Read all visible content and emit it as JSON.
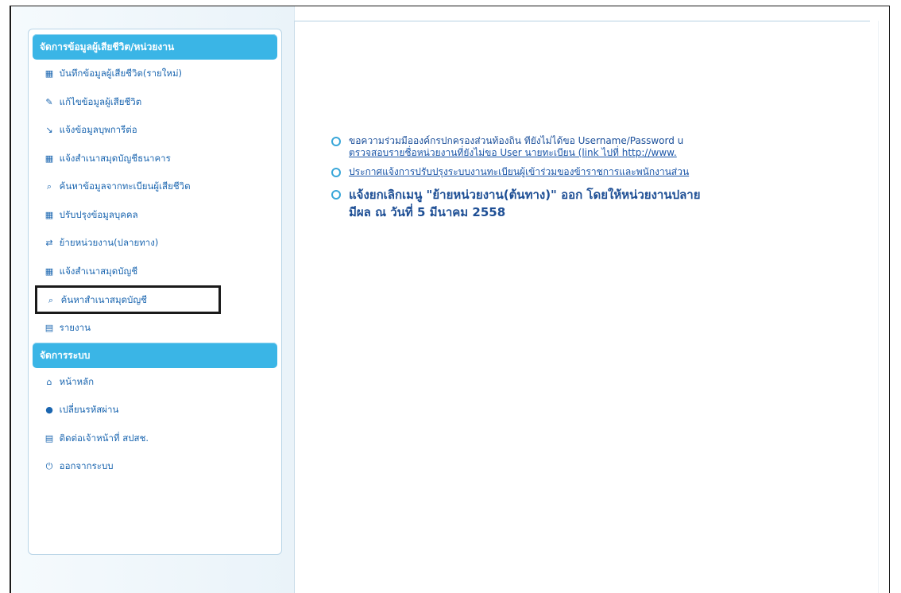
{
  "sidebar": {
    "sections": [
      {
        "header": "จัดการข้อมูลผู้เสียชีวิต/หน่วยงาน",
        "items": [
          {
            "icon": "book-icon",
            "glyph": "▦",
            "label": "บันทึกข้อมูลผู้เสียชีวิต(รายใหม่)"
          },
          {
            "icon": "pencil-icon",
            "glyph": "✎",
            "label": "แก้ไขข้อมูลผู้เสียชีวิต"
          },
          {
            "icon": "arrow-icon",
            "glyph": "↘",
            "label": "แจ้งข้อมูลบุพการีต่อ"
          },
          {
            "icon": "book-icon",
            "glyph": "▦",
            "label": "แจ้งสำเนาสมุดบัญชีธนาคาร"
          },
          {
            "icon": "search-icon",
            "glyph": "⌕",
            "label": "ค้นหาข้อมูลจากทะเบียนผู้เสียชีวิต"
          },
          {
            "icon": "book-icon",
            "glyph": "▦",
            "label": "ปรับปรุงข้อมูลบุคคล"
          },
          {
            "icon": "transfer-icon",
            "glyph": "⇄",
            "label": "ย้ายหน่วยงาน(ปลายทาง)"
          },
          {
            "icon": "book-icon",
            "glyph": "▦",
            "label": "แจ้งสำเนาสมุดบัญชี"
          },
          {
            "icon": "search-icon",
            "glyph": "⌕",
            "label": "ค้นหาสำเนาสมุดบัญชี",
            "highlighted": true
          },
          {
            "icon": "calendar-icon",
            "glyph": "▤",
            "label": "รายงาน"
          }
        ]
      },
      {
        "header": "จัดการระบบ",
        "items": [
          {
            "icon": "home-icon",
            "glyph": "⌂",
            "label": "หน้าหลัก"
          },
          {
            "icon": "lock-icon",
            "glyph": "●",
            "label": "เปลี่ยนรหัสผ่าน"
          },
          {
            "icon": "calendar-icon",
            "glyph": "▤",
            "label": "ติดต่อเจ้าหน้าที่ สปสช."
          },
          {
            "icon": "power-icon",
            "glyph": "⏻",
            "label": "ออกจากระบบ"
          }
        ]
      }
    ]
  },
  "announcements": [
    {
      "line1": "ขอความร่วมมือองค์กรปกครองส่วนท้องถิ่น ที่ยังไม่ได้ขอ Username/Password u",
      "line2": "ตรวจสอบรายชื่อหน่วยงานที่ยังไม่ขอ User นายทะเบียน (link ไปที่",
      "line2_url": "http://www.",
      "style": "normal"
    },
    {
      "line1": "ประกาศแจ้งการปรับปรุงระบบงานทะเบียนผู้เข้าร่วมของข้าราชการและพนักงานส่วน",
      "style": "link"
    },
    {
      "line1": "แจ้งยกเลิกเมนู \"ย้ายหน่วยงาน(ต้นทาง)\" ออก โดยให้หน่วยงานปลาย",
      "line2": "มีผล ณ วันที่ 5 มีนาคม 2558",
      "style": "big"
    }
  ],
  "colors": {
    "header_bg": "#3ab5e6",
    "menu_text": "#1b66b0",
    "announcement_text": "#1e4f95"
  }
}
